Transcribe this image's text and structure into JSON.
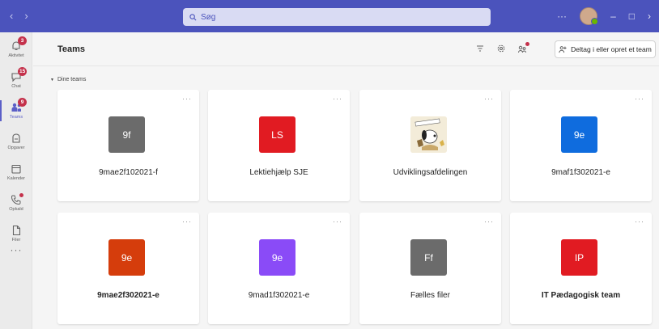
{
  "titlebar": {
    "back_icon": "‹",
    "forward_icon": "›",
    "search_placeholder": "Søg",
    "more_icon": "···",
    "minimize_icon": "–",
    "maximize_icon": "□",
    "close_icon": "›"
  },
  "rail": {
    "items": [
      {
        "label": "Aktivitet",
        "icon": "bell-icon",
        "badge": "3"
      },
      {
        "label": "Chat",
        "icon": "chat-icon",
        "badge": "15"
      },
      {
        "label": "Teams",
        "icon": "teams-icon",
        "badge": "9"
      },
      {
        "label": "Opgaver",
        "icon": "assignments-icon"
      },
      {
        "label": "Kalender",
        "icon": "calendar-icon"
      },
      {
        "label": "Opkald",
        "icon": "phone-icon"
      },
      {
        "label": "Filer",
        "icon": "file-icon"
      }
    ],
    "more": "···"
  },
  "header": {
    "title": "Teams",
    "join_label": "Deltag i eller opret et team"
  },
  "section": {
    "label": "Dine teams"
  },
  "teams": [
    {
      "initials": "9f",
      "name": "9mae2f102021-f",
      "color": "#6b6b6b",
      "bold": false
    },
    {
      "initials": "LS",
      "name": "Lektiehjælp SJE",
      "color": "#e11b22",
      "bold": false
    },
    {
      "initials": "",
      "name": "Udviklingsafdelingen",
      "color": "#f3ecd9",
      "bold": false
    },
    {
      "initials": "9e",
      "name": "9maf1f302021-e",
      "color": "#0f6cde",
      "bold": false
    },
    {
      "initials": "9e",
      "name": "9mae2f302021-e",
      "color": "#d53d0c",
      "bold": true
    },
    {
      "initials": "9e",
      "name": "9mad1f302021-e",
      "color": "#8a4bf7",
      "bold": false
    },
    {
      "initials": "Ff",
      "name": "Fælles filer",
      "color": "#6b6b6b",
      "bold": false
    },
    {
      "initials": "IP",
      "name": "IT Pædagogisk team",
      "color": "#e11b22",
      "bold": true
    }
  ],
  "card_more": "···"
}
